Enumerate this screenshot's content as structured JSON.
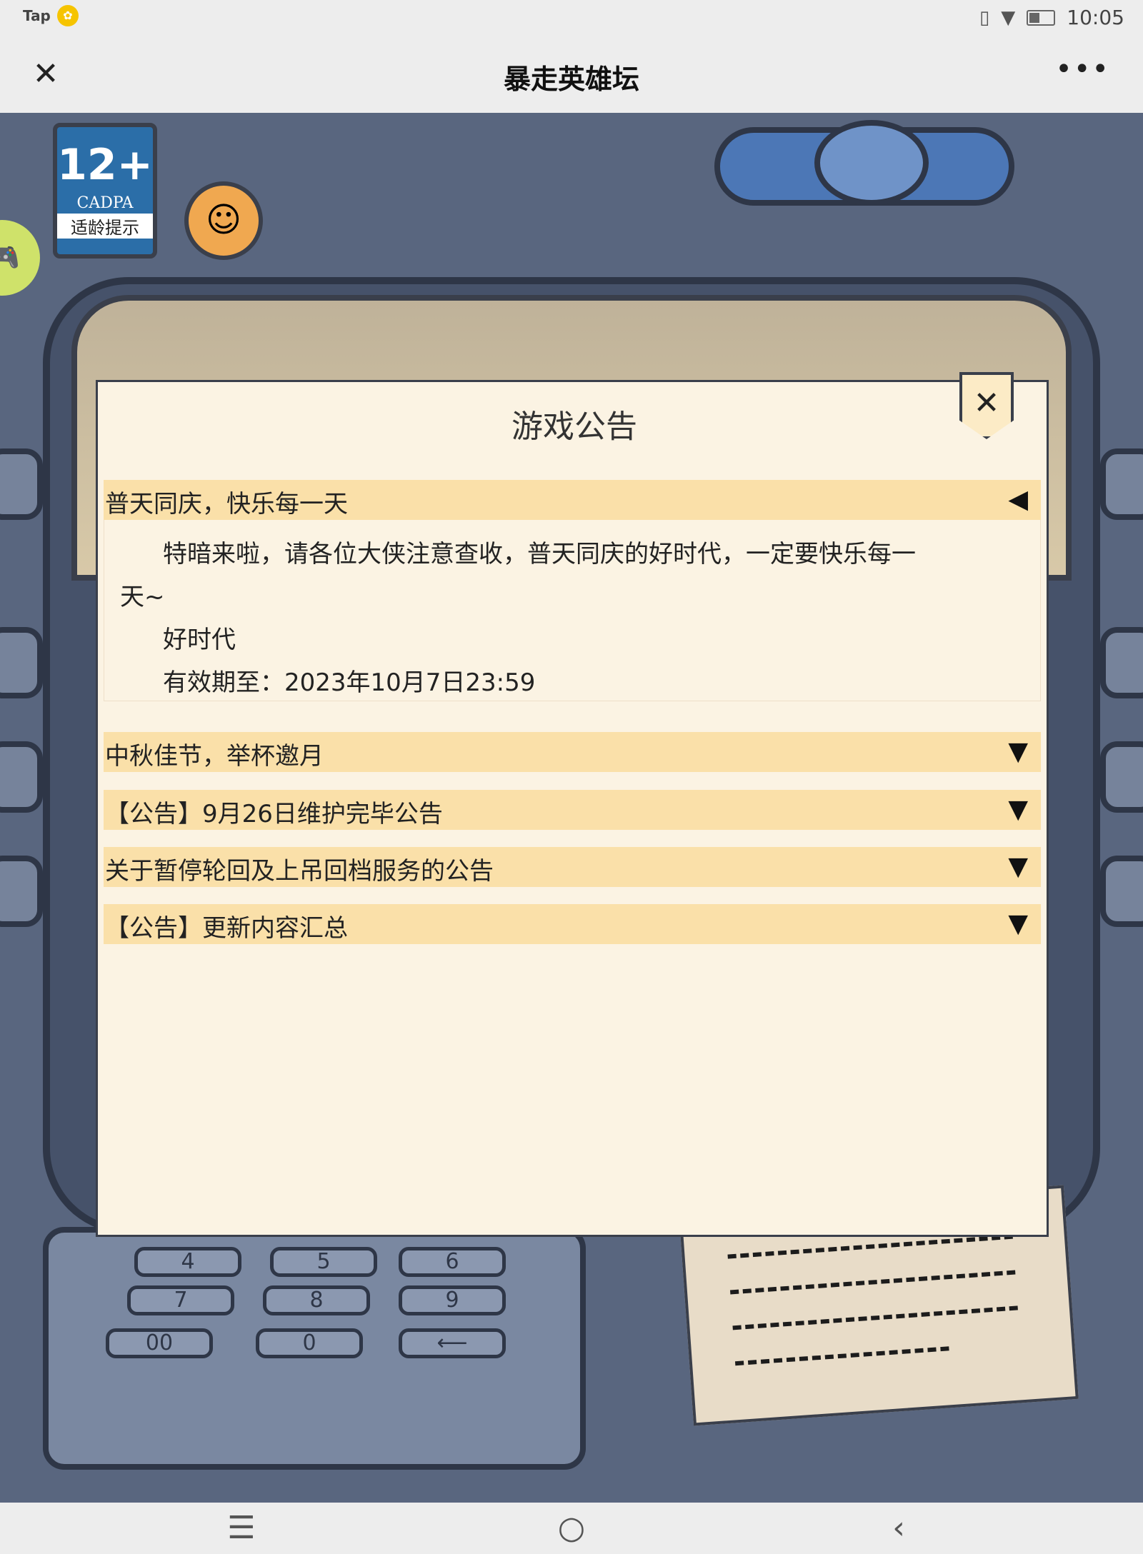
{
  "status_bar": {
    "app_tag": "Tap",
    "time": "10:05",
    "icons": [
      "vibrate-icon",
      "wifi-icon",
      "battery-icon"
    ]
  },
  "title_bar": {
    "title": "暴走英雄坛",
    "close_icon": "close-icon",
    "more_icon": "more-icon"
  },
  "game": {
    "age_rating": {
      "number": "12+",
      "org": "CADPA",
      "tip": "适龄提示"
    },
    "keypad": {
      "keys": [
        "4",
        "5",
        "6",
        "7",
        "8",
        "9",
        "00",
        "0",
        "⟵"
      ]
    }
  },
  "dialog": {
    "title": "游戏公告",
    "close_icon": "close-icon",
    "notices": [
      {
        "title": "普天同庆，快乐每一天",
        "expanded": true,
        "arrow": "◀",
        "body": [
          "特暗来啦，请各位大侠注意查收，普天同庆的好时代，一定要快乐每一",
          "天~",
          "好时代",
          "有效期至：2023年10月7日23:59"
        ]
      },
      {
        "title": "中秋佳节，举杯邀月",
        "expanded": false,
        "arrow": "▼"
      },
      {
        "title": "【公告】9月26日维护完毕公告",
        "expanded": false,
        "arrow": "▼"
      },
      {
        "title": "关于暂停轮回及上吊回档服务的公告",
        "expanded": false,
        "arrow": "▼"
      },
      {
        "title": "【公告】更新内容汇总",
        "expanded": false,
        "arrow": "▼"
      }
    ]
  },
  "nav_bar": {
    "menu_icon": "☰",
    "home_icon": "○",
    "back_icon": "‹"
  }
}
